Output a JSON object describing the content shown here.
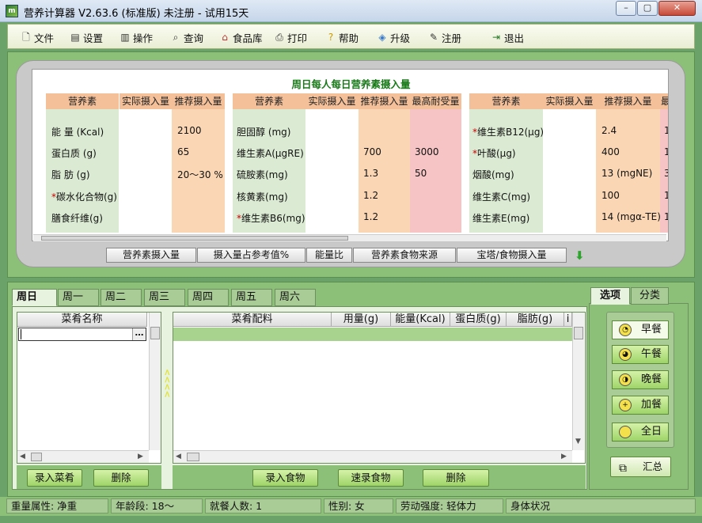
{
  "window": {
    "title": "营养计算器 V2.63.6 (标准版) 未注册 - 试用15天",
    "min": "–",
    "max": "▢",
    "close": "✕"
  },
  "menu": [
    {
      "label": "文件",
      "icon": "file-icon"
    },
    {
      "label": "设置",
      "icon": "settings-icon"
    },
    {
      "label": "操作",
      "icon": "chart-icon"
    },
    {
      "label": "查询",
      "icon": "search-icon"
    },
    {
      "label": "食品库",
      "icon": "house-icon"
    },
    {
      "label": "打印",
      "icon": "printer-icon"
    },
    {
      "label": "帮助",
      "icon": "help-icon"
    },
    {
      "label": "升级",
      "icon": "upgrade-icon"
    },
    {
      "label": "注册",
      "icon": "register-icon"
    },
    {
      "label": "退出",
      "icon": "exit-icon"
    }
  ],
  "nutrients": {
    "title": "周日每人每日营养素摄入量",
    "group1": {
      "headers": [
        "营养素",
        "实际摄入量",
        "推荐摄入量"
      ],
      "rows": [
        {
          "name": "能 量 (Kcal)",
          "star": false,
          "recommended": "2100"
        },
        {
          "name": "蛋白质 (g)",
          "star": false,
          "recommended": "65"
        },
        {
          "name": "脂 肪 (g)",
          "star": false,
          "recommended": "20～30 %"
        },
        {
          "name": "碳水化合物(g)",
          "star": true,
          "recommended": ""
        },
        {
          "name": "膳食纤维(g)",
          "star": false,
          "recommended": ""
        }
      ]
    },
    "group2": {
      "headers": [
        "营养素",
        "实际摄入量",
        "推荐摄入量",
        "最高耐受量"
      ],
      "rows": [
        {
          "name": "胆固醇 (mg)",
          "star": false,
          "recommended": "",
          "max": ""
        },
        {
          "name": "维生素A(μgRE)",
          "star": false,
          "recommended": "700",
          "max": "3000"
        },
        {
          "name": "硫胺素(mg)",
          "star": false,
          "recommended": "1.3",
          "max": "50"
        },
        {
          "name": "核黄素(mg)",
          "star": false,
          "recommended": "1.2",
          "max": ""
        },
        {
          "name": "维生素B6(mg)",
          "star": true,
          "recommended": "1.2",
          "max": ""
        }
      ]
    },
    "group3": {
      "headers": [
        "营养素",
        "实际摄入量",
        "推荐摄入量",
        "最"
      ],
      "rows": [
        {
          "name": "维生素B12(μg)",
          "star": true,
          "recommended": "2.4",
          "max": "1"
        },
        {
          "name": "叶酸(μg)",
          "star": true,
          "recommended": "400",
          "max": "1"
        },
        {
          "name": "烟酸(mg)",
          "star": false,
          "recommended": "13 (mgNE)",
          "max": "3"
        },
        {
          "name": "维生素C(mg)",
          "star": false,
          "recommended": "100",
          "max": "1"
        },
        {
          "name": "维生素E(mg)",
          "star": false,
          "recommended": "14 (mgα-TE)",
          "max": "1"
        }
      ]
    }
  },
  "nav_tabs": [
    "营养素摄入量",
    "摄入量占参考值%",
    "能量比",
    "营养素食物来源",
    "宝塔/食物摄入量"
  ],
  "days": [
    "周日",
    "周一",
    "周二",
    "周三",
    "周四",
    "周五",
    "周六"
  ],
  "dish_grid": {
    "header": "菜肴名称",
    "ellipsis": "…"
  },
  "ingredient_grid": {
    "headers": [
      "菜肴配料",
      "用量(g)",
      "能量(Kcal)",
      "蛋白质(g)",
      "脂肪(g)",
      "i"
    ]
  },
  "expand_arrows": "<<<<",
  "buttons": {
    "add_dish": "录入菜肴",
    "delete_dish": "删除",
    "add_food": "录入食物",
    "quick_food": "速录食物",
    "delete_food": "删除"
  },
  "right_tabs": [
    "选项",
    "分类"
  ],
  "meals": [
    {
      "label": "早餐",
      "icon": "clock-icon",
      "active": true
    },
    {
      "label": "午餐",
      "icon": "clock-icon",
      "active": false
    },
    {
      "label": "晚餐",
      "icon": "clock-icon",
      "active": false
    },
    {
      "label": "加餐",
      "icon": "plus-icon",
      "active": false
    },
    {
      "label": "全日",
      "icon": "circle-icon",
      "active": false
    }
  ],
  "summary_label": "汇总",
  "status": [
    "重量属性: 净重",
    "年龄段: 18～",
    "就餐人数: 1",
    "性别: 女",
    "劳动强度: 轻体力",
    "身体状况"
  ],
  "colors": {
    "frame": "#6aa26a",
    "panel": "#8cbf78",
    "nutrient_header": "#f4c09a",
    "name_col": "#dbead2",
    "recommended_col": "#fad6b4",
    "max_col": "#f6c4c4",
    "title_green": "#1a7a1a"
  }
}
